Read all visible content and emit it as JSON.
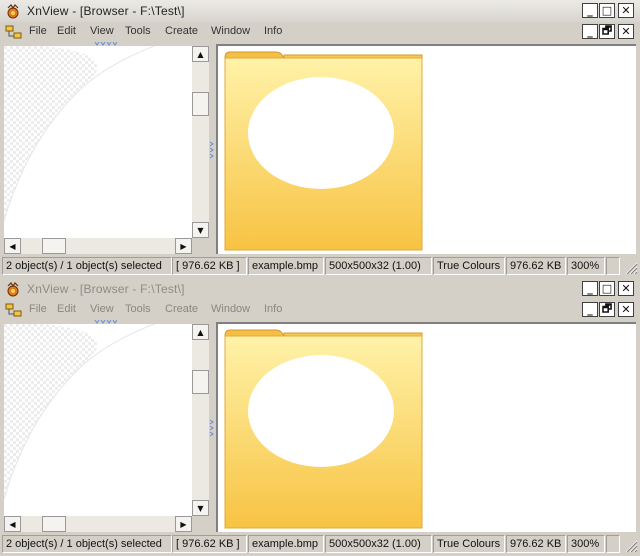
{
  "windows": [
    {
      "state": "active",
      "title": "XnView - [Browser - F:\\Test\\]",
      "menu": [
        "File",
        "Edit",
        "View",
        "Tools",
        "Create",
        "Window",
        "Info"
      ],
      "status": {
        "objects": "2 object(s) / 1 object(s) selected",
        "size": "[ 976.62 KB ]",
        "filename": "example.bmp",
        "dimensions": "500x500x32 (1.00)",
        "colours": "True Colours",
        "filesize": "976.62 KB",
        "zoom": "300%"
      }
    },
    {
      "state": "inactive",
      "title": "XnView - [Browser - F:\\Test\\]",
      "menu": [
        "File",
        "Edit",
        "View",
        "Tools",
        "Create",
        "Window",
        "Info"
      ],
      "status": {
        "objects": "2 object(s) / 1 object(s) selected",
        "size": "[ 976.62 KB ]",
        "filename": "example.bmp",
        "dimensions": "500x500x32 (1.00)",
        "colours": "True Colours",
        "filesize": "976.62 KB",
        "zoom": "300%"
      }
    }
  ],
  "caption_buttons": {
    "minimize": "_",
    "maximize": "□",
    "close": "✕",
    "restore": "🗗"
  },
  "icons": [
    "xnview-app-icon",
    "browser-tree-icon",
    "folder-image-icon",
    "scroll-arrow-icons",
    "size-grip-icon"
  ],
  "colors": {
    "folder_top": "#fff2a8",
    "folder_bottom": "#f7c343",
    "chrome": "#d4d0c8"
  }
}
